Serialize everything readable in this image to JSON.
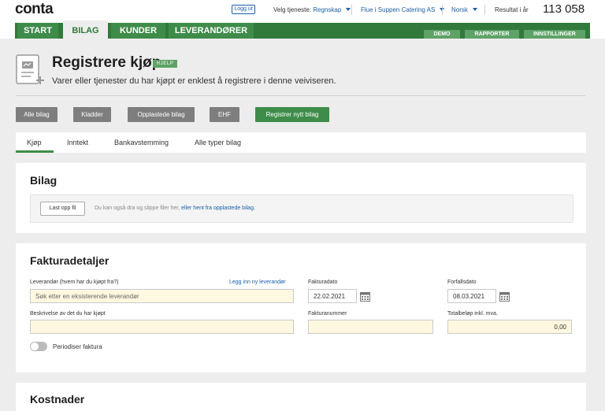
{
  "app": {
    "logo": "conta"
  },
  "topbar": {
    "logout_label": "Logg ut",
    "service_label": "Velg tjeneste:",
    "service_value": "Regnskap",
    "company": "Flue i Suppen Catering AS",
    "language": "Norsk",
    "result_label": "Resultat i år",
    "result_value": "113 058"
  },
  "nav": {
    "tabs": [
      "START",
      "BILAG",
      "KUNDER",
      "LEVERANDØRER"
    ],
    "active": "BILAG",
    "right_tabs": [
      "DEMO",
      "RAPPORTER",
      "INNSTILLINGER"
    ]
  },
  "header": {
    "title": "Registrere kjøp",
    "help_badge": "HJELP",
    "subtitle": "Varer eller tjenester du har kjøpt er enklest å registrere i denne veiviseren."
  },
  "filters": [
    "Alle bilag",
    "Kladder",
    "Opplastede bilag",
    "EHF",
    "Registrer nytt bilag"
  ],
  "subtabs": [
    "Kjøp",
    "Inntekt",
    "Bankavstemming",
    "Alle typer bilag"
  ],
  "bilag": {
    "title": "Bilag",
    "upload_label": "Last opp fil",
    "drop_text": "Du kan også dra og slippe filer her, ",
    "drop_link": "eller hent fra opplastede bilag."
  },
  "faktura": {
    "title": "Fakturadetaljer",
    "supplier_label": "Leverandør (hvem har du kjøpt fra?)",
    "new_supplier_link": "Legg inn ny leverandør",
    "supplier_placeholder": "Søk etter en eksisterende leverandør",
    "invoice_date_label": "Fakturadato",
    "invoice_date": "22.02.2021",
    "due_date_label": "Forfallsdato",
    "due_date": "08.03.2021",
    "description_label": "Beskrivelse av det du har kjøpt",
    "invoice_number_label": "Fakturanummer",
    "total_label": "Totalbeløp inkl. mva.",
    "total_value": "0,00",
    "periodize_label": "Periodiser faktura"
  },
  "kostnader": {
    "title": "Kostnader"
  }
}
